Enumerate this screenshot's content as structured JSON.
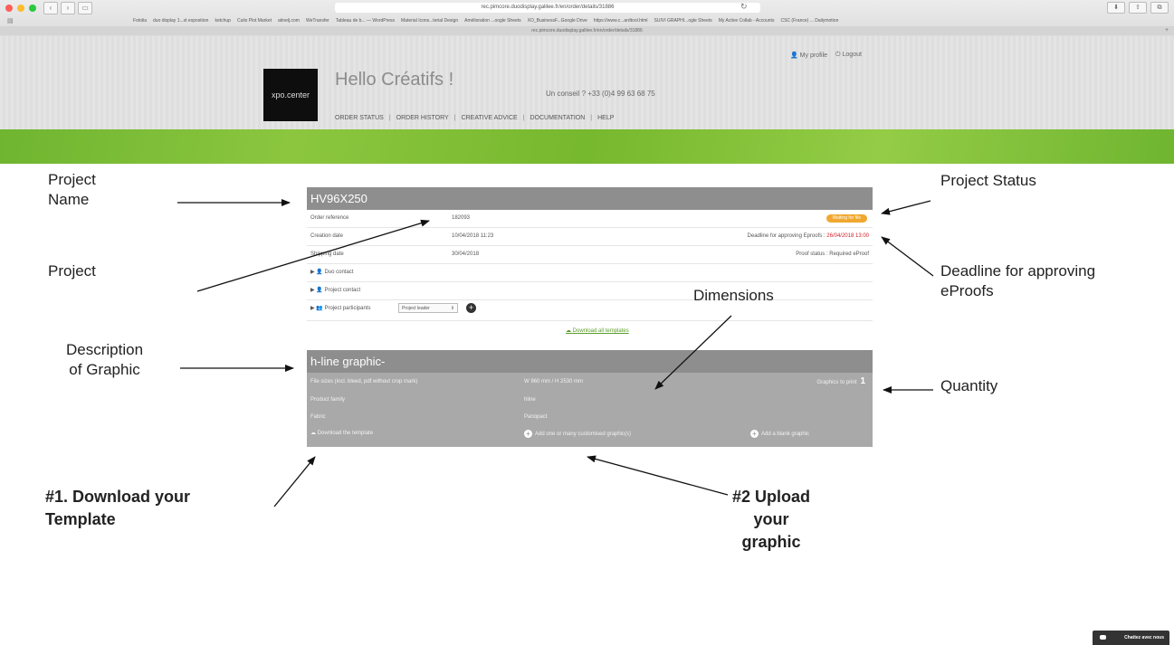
{
  "browser": {
    "url": "rec.pimcore.duodisplay.galilee.fr/en/order/details/31886",
    "tab_url": "rec.pimcore.duodisplay.galilee.fr/en/order/details/31886",
    "bookmarks": [
      "Fotolia",
      "duo display 1...xt exposition",
      "ketchup",
      "Cutix Plot Market",
      "atinelj.com",
      "WeTransfer",
      "Tableau de b... — WordPress",
      "Material Icons...terial Design",
      "Amélioration ...oogle Sheets",
      "XO_BusinessF...Google Drive",
      "https://www.c...ardtool.html",
      "SUIVI GRAPHI...ogle Sheets",
      "My Active Collab - Accounts",
      "CSC (France) ... Dailymotion"
    ]
  },
  "header": {
    "logo": "xpo.center",
    "greeting": "Hello Créatifs !",
    "advice_phone": "Un conseil ? +33 (0)4 99 63 68 75",
    "nav": [
      "ORDER STATUS",
      "ORDER HISTORY",
      "CREATIVE ADVICE",
      "DOCUMENTATION",
      "HELP"
    ],
    "my_profile": "My profile",
    "logout": "Logout"
  },
  "project": {
    "name": "HV96X250",
    "order_reference_label": "Order reference",
    "order_reference": "182093",
    "status": "Waiting for file",
    "creation_date_label": "Creation date",
    "creation_date": "10/04/2018 11:23",
    "deadline_label": "Deadline for approving Eproofs :",
    "deadline": "26/04/2018 13:00",
    "shipping_date_label": "Shipping date",
    "shipping_date": "30/04/2018",
    "proof_status": "Proof status : Required eProof",
    "duo_contact": "Duo contact",
    "project_contact": "Project contact",
    "project_participants": "Project participants",
    "participant_role": "Project leader",
    "download_all": "Download all templates"
  },
  "graphic": {
    "title": "h-line graphic-",
    "file_sizes_label": "File sizes (incl. bleed, pdf without crop mark)",
    "dimensions": "W 960 mm / H 2530 mm",
    "graphics_to_print_label": "Graphics to print",
    "quantity": "1",
    "product_family_label": "Product family",
    "product_family": "hline",
    "fabric_label": "Fabric",
    "fabric": "Panopact",
    "download_template": "Download the template",
    "add_custom": "Add one or many customised graphic(s)",
    "add_blank": "Add a blank graphic"
  },
  "annotations": {
    "project_name": "Project\nName",
    "project": "Project",
    "description": "Description\nof Graphic",
    "project_status": "Project Status",
    "deadline": "Deadline for approving\neProofs",
    "dimensions": "Dimensions",
    "quantity": "Quantity",
    "step1": "#1. Download your\nTemplate",
    "step2": "#2 Upload\nyour\ngraphic"
  },
  "chat": "Chattez avec nous",
  "colors": {
    "green": "#8cc63f",
    "panel_header": "#8e8e8e",
    "badge": "#f0a830",
    "deadline": "#d0202a"
  }
}
